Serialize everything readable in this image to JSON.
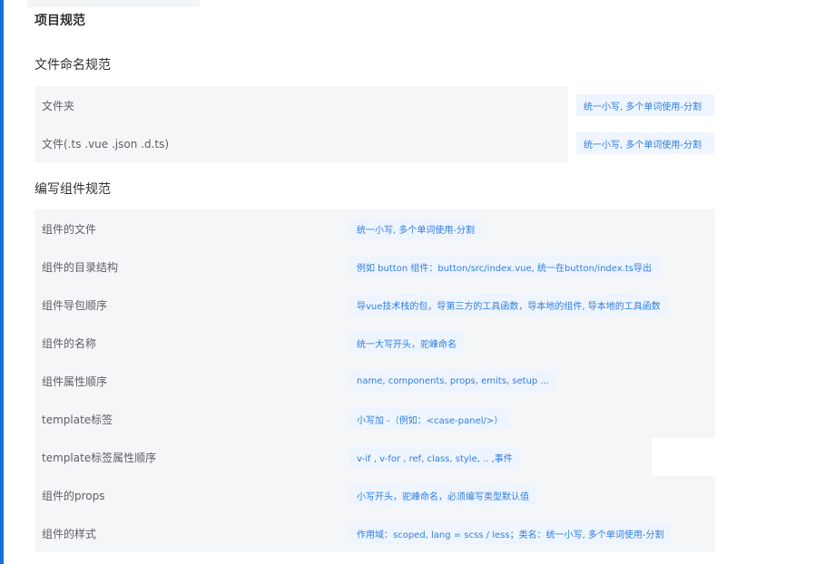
{
  "page_title": "项目规范",
  "sections": [
    {
      "title": "文件命名规范",
      "rows": [
        {
          "label": "文件夹",
          "value": "统一小写, 多个单词使用-分割"
        },
        {
          "label": "文件(.ts .vue .json .d.ts)",
          "value": "统一小写, 多个单词使用-分割"
        }
      ]
    },
    {
      "title": "编写组件规范",
      "rows": [
        {
          "label": "组件的文件",
          "value": "统一小写, 多个单词使用-分割"
        },
        {
          "label": "组件的目录结构",
          "value": "例如 button 组件：button/src/index.vue, 统一在button/index.ts导出"
        },
        {
          "label": "组件导包顺序",
          "value": "导vue技术栈的包，导第三方的工具函数，导本地的组件, 导本地的工具函数"
        },
        {
          "label": "组件的名称",
          "value": "统一大写开头，驼峰命名"
        },
        {
          "label": "组件属性顺序",
          "value": "name, components, props, emits, setup ..."
        },
        {
          "label": "template标签",
          "value": "小写加 -（例如：<case-panel/>）"
        },
        {
          "label": "template标签属性顺序",
          "value": "v-if , v-for , ref, class, style, .. ,事件"
        },
        {
          "label": "组件的props",
          "value": "小写开头，驼峰命名，必须编写类型默认值"
        },
        {
          "label": "组件的样式",
          "value": "作用域：scoped, lang = scss / less；类名：统一小写, 多个单词使用-分割"
        }
      ]
    }
  ],
  "colors": {
    "accent": "#1a6fd8",
    "tag_text": "#2f7de1",
    "tag_bg": "#eef5ff",
    "row_bg": "#f5f6f8"
  }
}
